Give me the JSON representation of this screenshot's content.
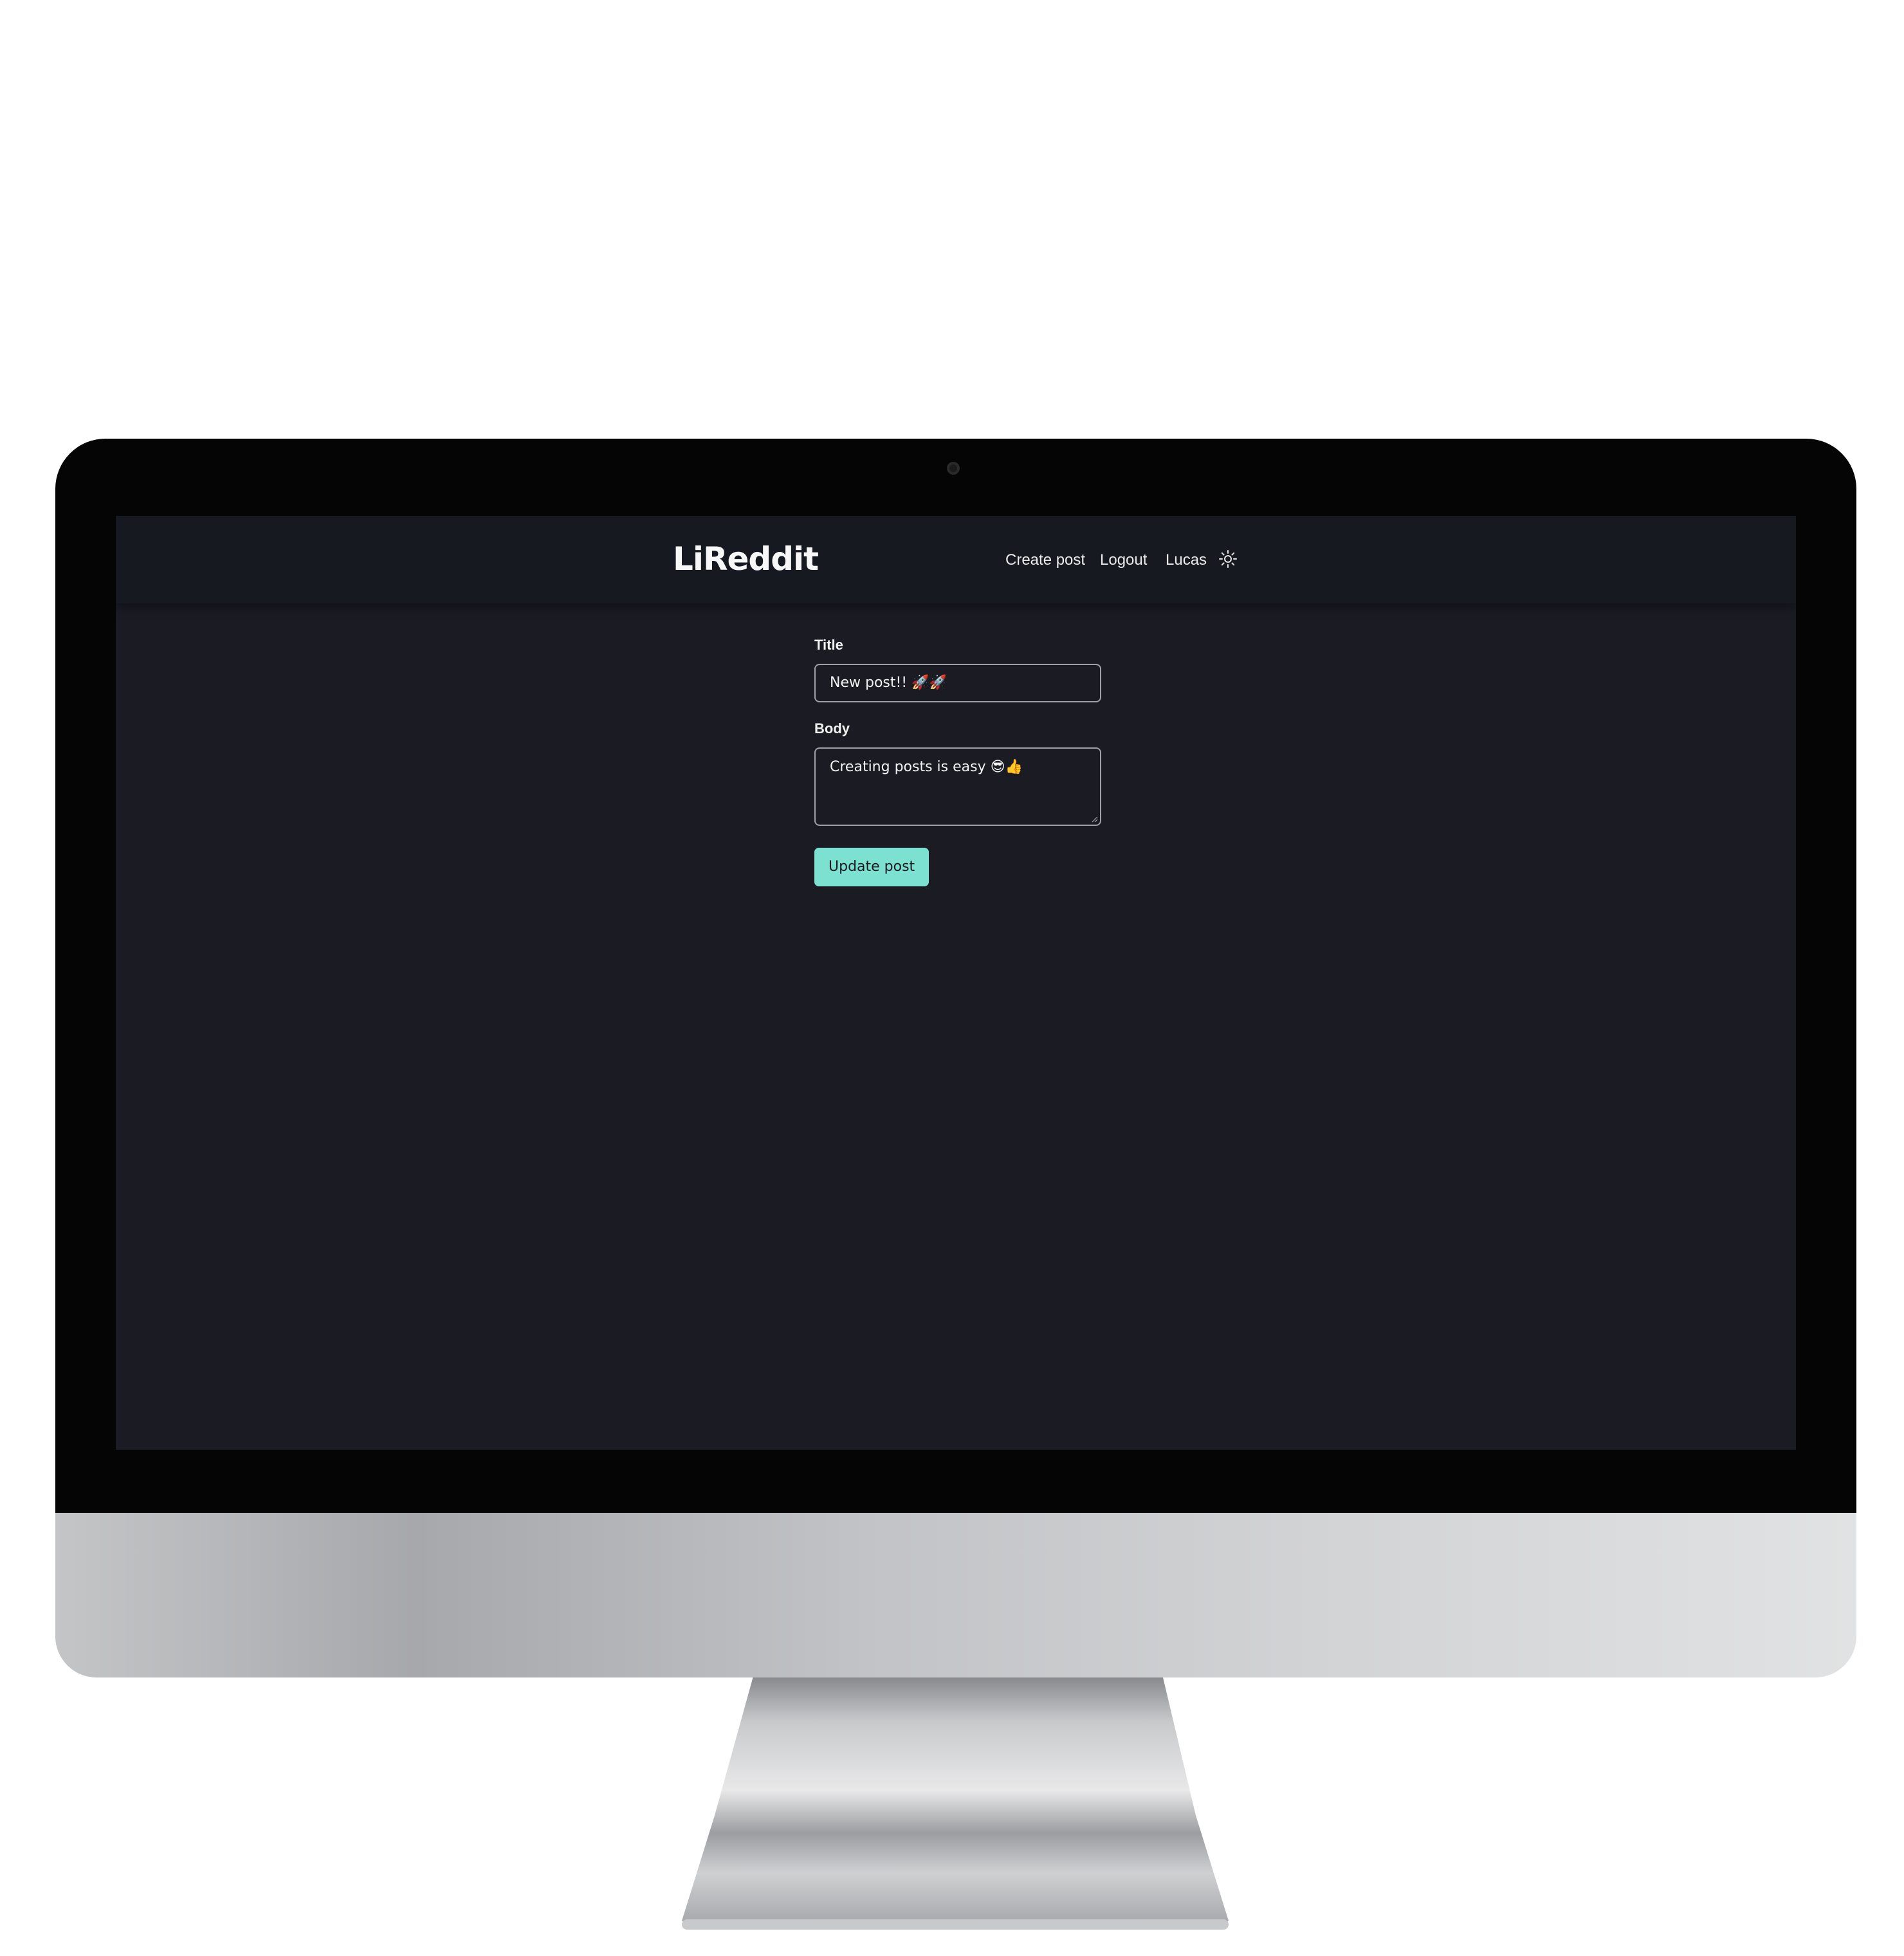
{
  "app": {
    "logo": "LiReddit"
  },
  "navbar": {
    "links": [
      {
        "label": "Create post"
      },
      {
        "label": "Logout"
      }
    ],
    "username": "Lucas",
    "theme_icon": "sun-icon"
  },
  "form": {
    "title_label": "Title",
    "title_value": "New post!! 🚀🚀",
    "body_label": "Body",
    "body_value": "Creating posts is easy 😎👍",
    "submit_label": "Update post"
  },
  "colors": {
    "accent": "#7de1d1",
    "screen_background": "#1a1b23",
    "navbar_background": "#171921"
  }
}
